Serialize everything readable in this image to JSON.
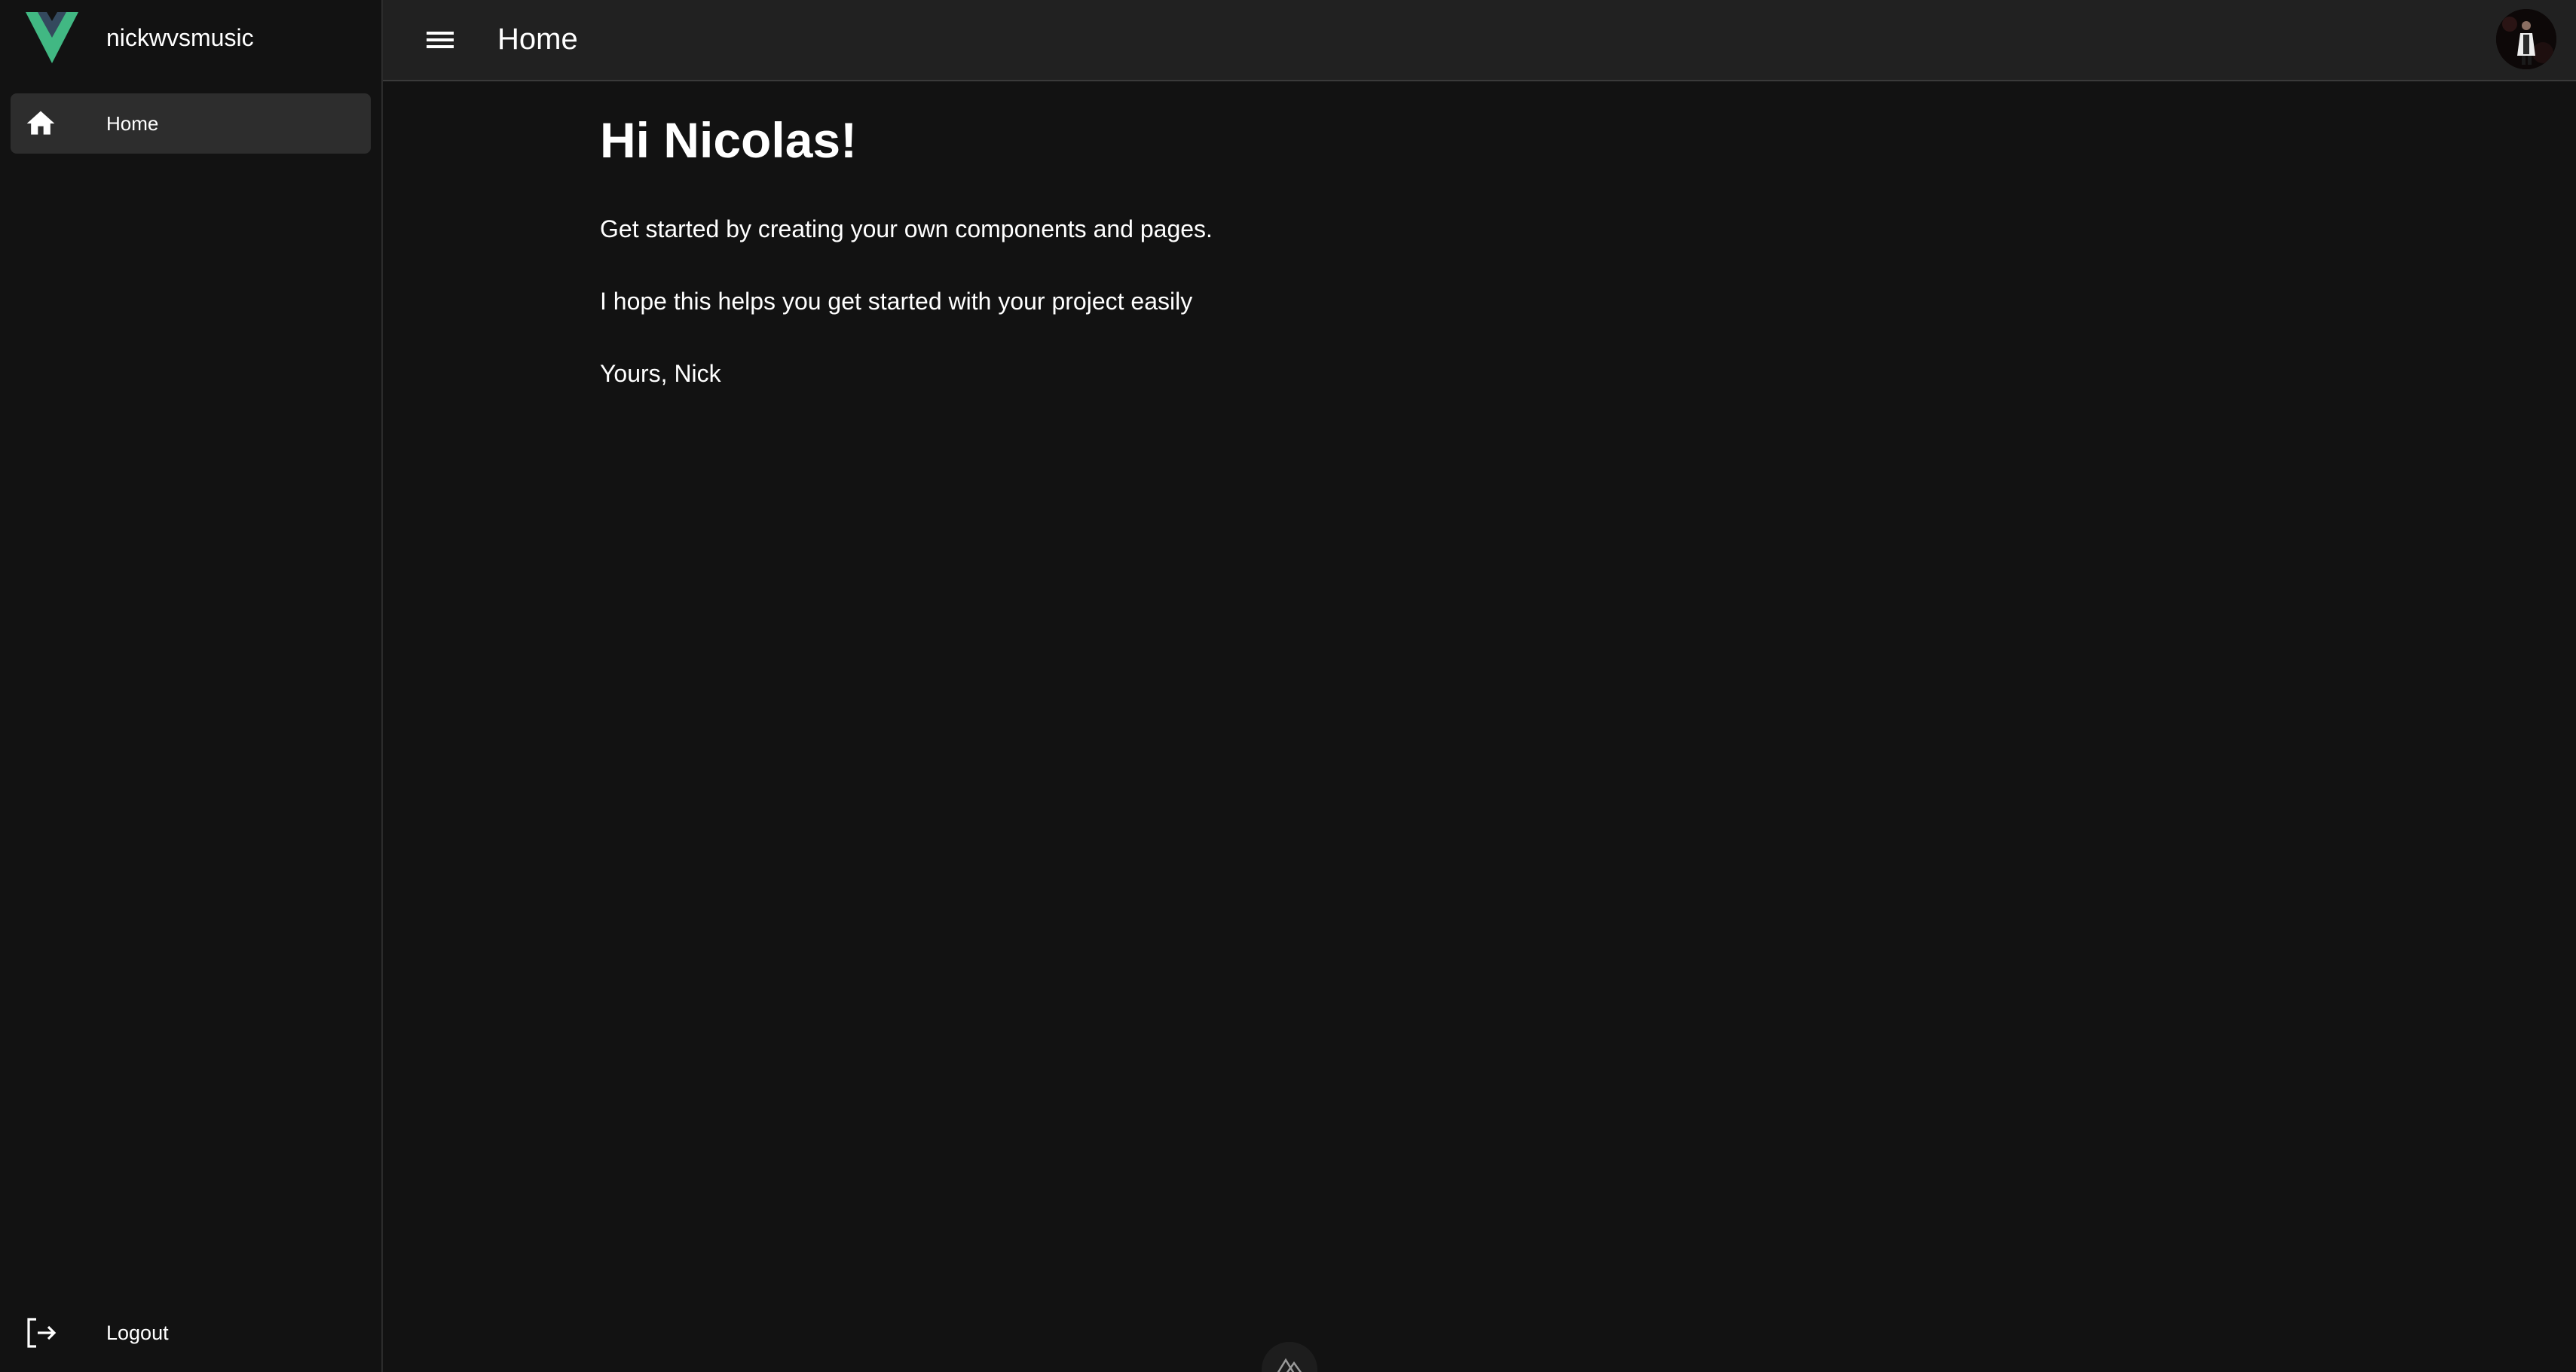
{
  "sidebar": {
    "brand_name": "nickwvsmusic",
    "items": [
      {
        "label": "Home",
        "icon": "home-icon"
      }
    ],
    "logout_label": "Logout"
  },
  "topbar": {
    "title": "Home"
  },
  "main": {
    "greeting": "Hi Nicolas!",
    "paragraphs": [
      "Get started by creating your own components and pages.",
      "I hope this helps you get started with your project easily",
      "Yours, Nick"
    ]
  },
  "colors": {
    "background": "#121212",
    "topbar": "#212121",
    "active_item": "#2d2d2d",
    "logo_green": "#41b883",
    "logo_dark": "#34495e"
  }
}
